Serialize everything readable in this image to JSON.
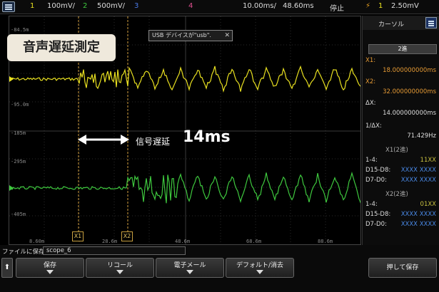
{
  "top_bar": {
    "ch1_num": "1",
    "ch1_scale": "100mV/",
    "ch2_num": "2",
    "ch2_scale": "500mV/",
    "ch3_num": "3",
    "ch4_num": "4",
    "timebase": "10.00ms/",
    "delay": "48.60ms",
    "run_state": "停止",
    "trigger_icon": "lightning-icon",
    "trigger_ch": "1",
    "trigger_level": "2.50mV",
    "colors": {
      "ch1": "#e8e020",
      "ch2": "#3ec83e",
      "ch3": "#4a7ae8",
      "ch4": "#e05090"
    }
  },
  "graticule": {
    "y_labels": [
      "-84.5m",
      "-95.0m",
      "-185m",
      "-295m",
      "-405m"
    ],
    "x_labels": [
      "8.60m",
      "28.6m",
      "48.6m",
      "68.6m",
      "88.6m"
    ]
  },
  "title_badge": "音声遅延測定",
  "usb_message": "USB デバイスが\"usb\".",
  "delay_annotation": {
    "label": "信号遅延",
    "value": "14ms"
  },
  "cursor_tags": {
    "x1": "X1",
    "x2": "X2"
  },
  "right_panel": {
    "header": "カーソル",
    "mode_button": "2進",
    "x1_label": "X1:",
    "x1_value": "18.000000000ms",
    "x2_label": "X2:",
    "x2_value": "32.000000000ms",
    "dx_label": "ΔX:",
    "dx_value": "14.000000000ms",
    "inv_dx_label": "1/ΔX:",
    "inv_dx_value": "71.429Hz",
    "x1_section": "X1(2進)",
    "x2_section": "X2(2進)",
    "x1_rows": [
      {
        "label": "1-4:",
        "value": "11XX"
      },
      {
        "label": "D15-D8:",
        "value": "XXXX XXXX"
      },
      {
        "label": "D7-D0:",
        "value": "XXXX XXXX"
      }
    ],
    "x2_rows": [
      {
        "label": "1-4:",
        "value": "01XX"
      },
      {
        "label": "D15-D8:",
        "value": "XXXX XXXX"
      },
      {
        "label": "D7-D0:",
        "value": "XXXX XXXX"
      }
    ]
  },
  "bottom_bar": {
    "save_label": "ファイルに保存 =",
    "save_value": "scope_6",
    "up_icon": "up-arrow-icon",
    "softkeys": [
      "保存",
      "リコール",
      "電子メール",
      "デフォルト/消去"
    ],
    "press_save": "押して保存"
  }
}
